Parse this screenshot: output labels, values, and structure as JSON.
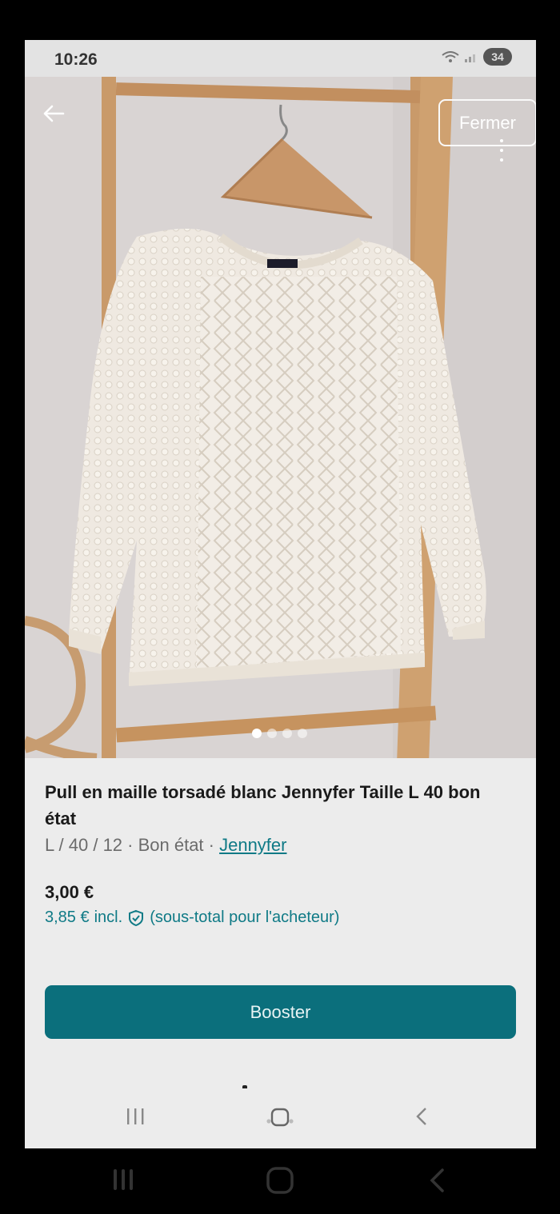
{
  "status_bar": {
    "time": "10:26",
    "battery": "34"
  },
  "gallery": {
    "close_label": "Fermer",
    "dot_count": 4,
    "active_index": 0
  },
  "product": {
    "title": "Pull en maille torsadé blanc Jennyfer Taille L 40 bon état",
    "meta_prefix": "L / 40 / 12 · Bon état · ",
    "brand": "Jennyfer",
    "price": "3,00 €",
    "price_incl_value": "3,85 €",
    "price_incl_label": "incl.",
    "price_incl_note": "(sous-total pour l'acheteur)"
  },
  "actions": {
    "booster_label": "Booster"
  },
  "icons": {
    "back": "arrow-left-icon",
    "menu": "more-vertical-icon",
    "shield": "shield-check-icon",
    "nav": [
      "recents-icon",
      "home-icon",
      "back-chevron-icon"
    ]
  },
  "colors": {
    "accent": "#0b6f7c",
    "link": "#0f7a86"
  }
}
